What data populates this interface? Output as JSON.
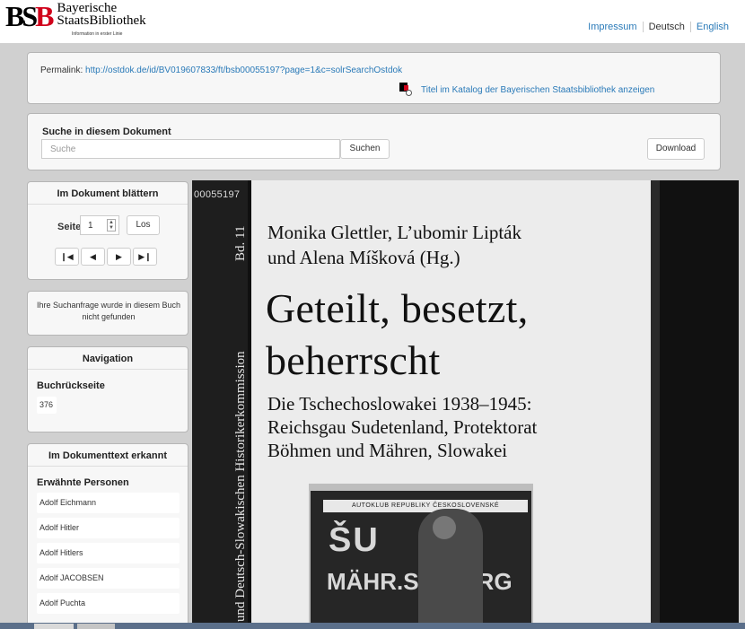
{
  "header": {
    "logo_mark": "BSB",
    "logo_line1": "Bayerische",
    "logo_line2": "StaatsBibliothek",
    "logo_tagline": "Information in erster Linie",
    "links": [
      "Impressum",
      "Deutsch",
      "English"
    ]
  },
  "permalink": {
    "label": "Permalink:",
    "url": "http://ostdok.de/id/BV019607833/ft/bsb00055197?page=1&c=solrSearchOstdok",
    "catalog_link": "Titel im Katalog der Bayerischen Staatsbibliothek anzeigen"
  },
  "search": {
    "title": "Suche in diesem Dokument",
    "placeholder": "Suche",
    "button": "Suchen",
    "download": "Download"
  },
  "browse": {
    "title": "Im Dokument blättern",
    "page_label": "Seite",
    "page_value": "1",
    "go": "Los",
    "first": "⏮",
    "prev": "◀",
    "next": "▶",
    "last": "⏭"
  },
  "search_message": "Ihre Suchanfrage wurde in diesem Buch nicht gefunden",
  "navigation": {
    "title": "Navigation",
    "sub": "Buchrückseite",
    "value": "376"
  },
  "recognized": {
    "title": "Im Dokumenttext erkannt",
    "sub": "Erwähnte Personen",
    "persons": [
      "Adolf Eichmann",
      "Adolf Hitler",
      "Adolf Hitlers",
      "Adolf JACOBSEN",
      "Adolf Puchta"
    ]
  },
  "viewer": {
    "id_tag": "00055197",
    "spine_volume": "Bd. 11",
    "spine_text": "und Deutsch-Slowakischen Historikerkommission",
    "authors_line1": "Monika Glettler, L’ubomir Lipták",
    "authors_line2": "und Alena Míšková (Hg.)",
    "title_line1": "Geteilt, besetzt,",
    "title_line2": "beherrscht",
    "subtitle_line1": "Die Tschechoslowakei 1938–1945:",
    "subtitle_line2": "Reichsgau Sudetenland, Protektorat",
    "subtitle_line3": "Böhmen und Mähren, Slowakei",
    "photo_banner": "AUTOKLUB REPUBLIKY ČESKOSLOVENSKÉ",
    "photo_big1": "ŠU",
    "photo_big2": "MÄHR.SCHÖ      RG"
  }
}
